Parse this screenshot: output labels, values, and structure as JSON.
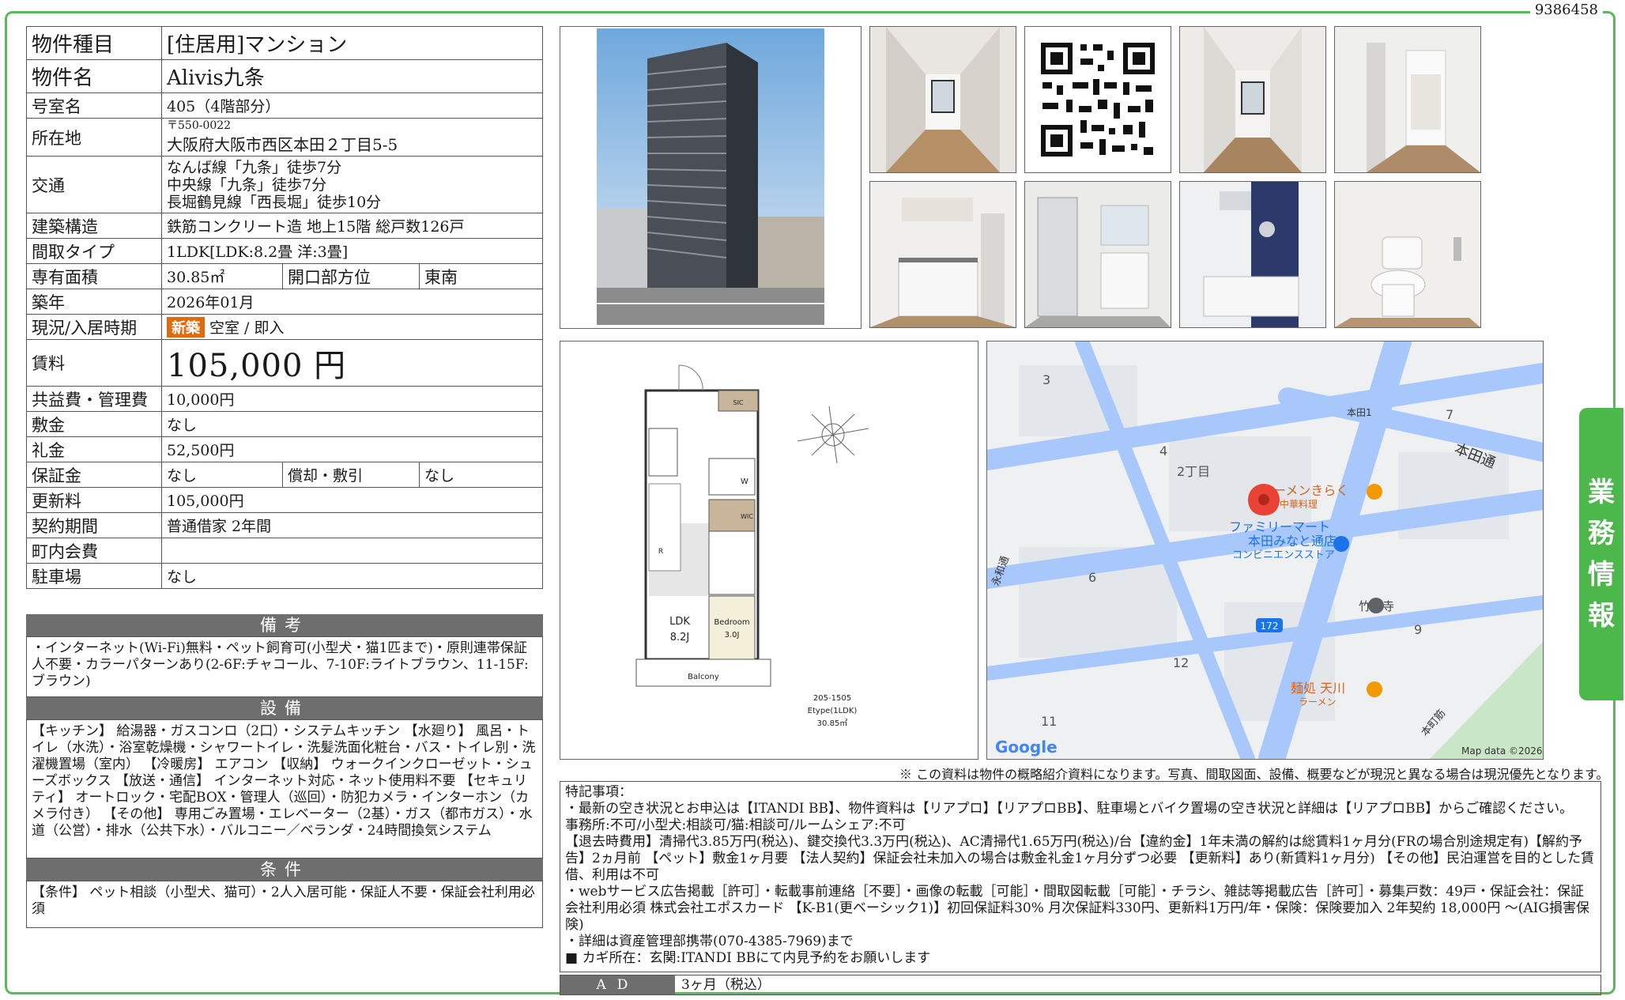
{
  "doc_number": "9386458",
  "table": {
    "type_label": "物件種目",
    "type_value": "[住居用]マンション",
    "name_label": "物件名",
    "name_value": "Alivis九条",
    "room_label": "号室名",
    "room_value": "405（4階部分）",
    "address_label": "所在地",
    "zip": "〒550-0022",
    "address_value": "大阪府大阪市西区本田２丁目5-5",
    "transit_label": "交通",
    "transit_1": "なんば線「九条」徒歩7分",
    "transit_2": "中央線「九条」徒歩7分",
    "transit_3": "長堀鶴見線「西長堀」徒歩10分",
    "structure_label": "建築構造",
    "structure_value": "鉄筋コンクリート造 地上15階 総戸数126戸",
    "layout_label": "間取タイプ",
    "layout_value": "1LDK[LDK:8.2畳 洋:3畳]",
    "area_label": "専有面積",
    "area_value": "30.85㎡",
    "direction_label": "開口部方位",
    "direction_value": "東南",
    "built_label": "築年",
    "built_value": "2026年01月",
    "status_label": "現況/入居時期",
    "status_badge": "新築",
    "status_value": "空室 / 即入",
    "rent_label": "賃料",
    "rent_value": "105,000 円",
    "mgmt_label": "共益費・管理費",
    "mgmt_value": "10,000円",
    "deposit_label": "敷金",
    "deposit_value": "なし",
    "key_label": "礼金",
    "key_value": "52,500円",
    "guarantee_label": "保証金",
    "guarantee_value": "なし",
    "amort_label": "償却・敷引",
    "amort_value": "なし",
    "renewal_label": "更新料",
    "renewal_value": "105,000円",
    "contract_label": "契約期間",
    "contract_value": "普通借家 2年間",
    "town_label": "町内会費",
    "town_value": "",
    "parking_label": "駐車場",
    "parking_value": "なし"
  },
  "remarks": {
    "title": "備考",
    "text": "・インターネット(Wi-Fi)無料・ペット飼育可(小型犬・猫1匹まで)・原則連帯保証人不要・カラーパターンあり(2-6F:チャコール、7-10F:ライトブラウン、11-15F:ブラウン)"
  },
  "equipment": {
    "title": "設備",
    "text": "【キッチン】 給湯器・ガスコンロ（2口）・システムキッチン 【水廻り】 風呂・トイレ（水洗）・浴室乾燥機・シャワートイレ・洗髪洗面化粧台・バス・トイレ別・洗濯機置場（室内） 【冷暖房】 エアコン 【収納】 ウォークインクローゼット・シューズボックス 【放送・通信】 インターネット対応・ネット使用料不要 【セキュリティ】 オートロック・宅配BOX・管理人（巡回）・防犯カメラ・インターホン（カメラ付き） 【その他】 専用ごみ置場・エレベーター（2基）・ガス（都市ガス）・水道（公営）・排水（公共下水）・バルコニー／ベランダ・24時間換気システム"
  },
  "conditions": {
    "title": "条件",
    "text": "【条件】 ペット相談（小型犬、猫可）・2人入居可能・保証人不要・保証会社利用必須"
  },
  "floorplan": {
    "ldk": "LDK",
    "ldk_size": "8.2J",
    "bed": "Bedroom",
    "bed_size": "3.0J",
    "balcony": "Balcony",
    "wic": "WIC",
    "sic": "SIC",
    "w": "W",
    "r": "R",
    "caption_1": "205-1505",
    "caption_2": "Etype(1LDK)",
    "caption_3": "30.85㎡"
  },
  "map": {
    "labels": [
      "3",
      "4",
      "2丁目",
      "6",
      "7",
      "9",
      "12",
      "11",
      "本田1",
      "本田通",
      "ラーメンきらく",
      "中華料理",
      "ファミリーマート",
      "本田みなと通店",
      "コンビニエンスストア",
      "竹林寺",
      "麺処 天川",
      "ラーメン",
      "172",
      "本町筋",
      "永和通"
    ],
    "google": "Google",
    "copyright": "Map data ©2026"
  },
  "disclaimer": "※ この資料は物件の概略紹介資料になります。写真、間取図面、設備、概要などが現況と異なる場合は現況優先となります。",
  "notes": {
    "l1": "特記事項：",
    "l2": "・最新の空き状況とお申込は【ITANDI BB】、物件資料は【リアプロ】【リアプロBB】、駐車場とバイク置場の空き状況と詳細は【リアプロBB】からご確認ください。",
    "l3": "事務所:不可/小型犬:相談可/猫:相談可/ルームシェア:不可",
    "l4": "【退去時費用】清掃代3.85万円(税込)、鍵交換代3.3万円(税込)、AC清掃代1.65万円(税込)/台【違約金】1年未満の解約は総賃料1ヶ月分(FRの場合別途規定有)【解約予告】2ヵ月前 【ペット】敷金1ヶ月要 【法人契約】保証会社未加入の場合は敷金礼金1ヶ月分ずつ必要 【更新料】あり(新賃料1ヶ月分) 【その他】民泊運営を目的とした賃借、利用は不可",
    "l5": "・webサービス広告掲載［許可］・転載事前連絡［不要］・画像の転載［可能］・間取図転載［可能］・チラシ、雑誌等掲載広告［許可］・募集戸数：49戸・保証会社：保証会社利用必須 株式会社エポスカード 【K-B1(更ベーシック1)】初回保証料30% 月次保証料330円、更新料1万円/年・保険：保険要加入 2年契約 18,000円 〜(AIG損害保険)",
    "l6": "・詳細は資産管理部携帯(070-4385-7969)まで",
    "l7": "■ カギ所在：玄関:ITANDI BBにて内見予約をお願いします"
  },
  "ad_label": "AD",
  "ad_value": "3ヶ月（税込）",
  "tab": [
    "業",
    "務",
    "情",
    "報"
  ]
}
